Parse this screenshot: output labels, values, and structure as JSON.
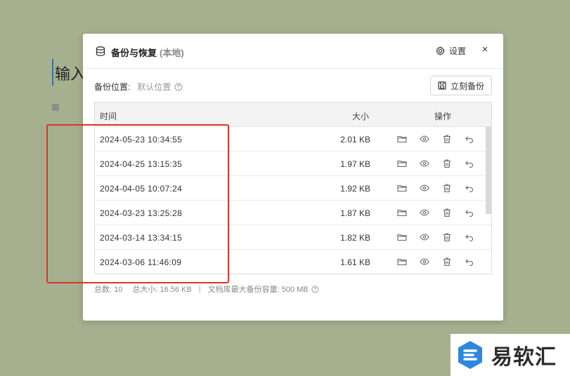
{
  "background": {
    "editor_text": "输入"
  },
  "dialog": {
    "title": "备份与恢复",
    "title_sub": "(本地)",
    "settings_label": "设置",
    "close_label": "×",
    "location_label": "备份位置:",
    "location_value": "默认位置",
    "backup_now_label": "立刻备份"
  },
  "table": {
    "headers": {
      "time": "时间",
      "size": "大小",
      "ops": "操作"
    },
    "rows": [
      {
        "time": "2024-05-23 10:34:55",
        "size": "2.01 KB"
      },
      {
        "time": "2024-04-25 13:15:35",
        "size": "1.97 KB"
      },
      {
        "time": "2024-04-05 10:07:24",
        "size": "1.92 KB"
      },
      {
        "time": "2024-03-23 13:25:28",
        "size": "1.87 KB"
      },
      {
        "time": "2024-03-14 13:34:15",
        "size": "1.82 KB"
      },
      {
        "time": "2024-03-06 11:46:09",
        "size": "1.61 KB"
      }
    ],
    "row_actions": [
      "folder-icon",
      "eye-icon",
      "trash-icon",
      "restore-icon"
    ]
  },
  "footer": {
    "total_count": "总数: 10",
    "total_size": "总大小: 16.56 KB",
    "separator": "|",
    "max_capacity": "文档库最大备份容量: 500 MB"
  },
  "watermark": {
    "text": "易软汇"
  },
  "colors": {
    "background": "#a6b08e",
    "highlight": "#d9342b",
    "logo_blue": "#2e86de"
  }
}
